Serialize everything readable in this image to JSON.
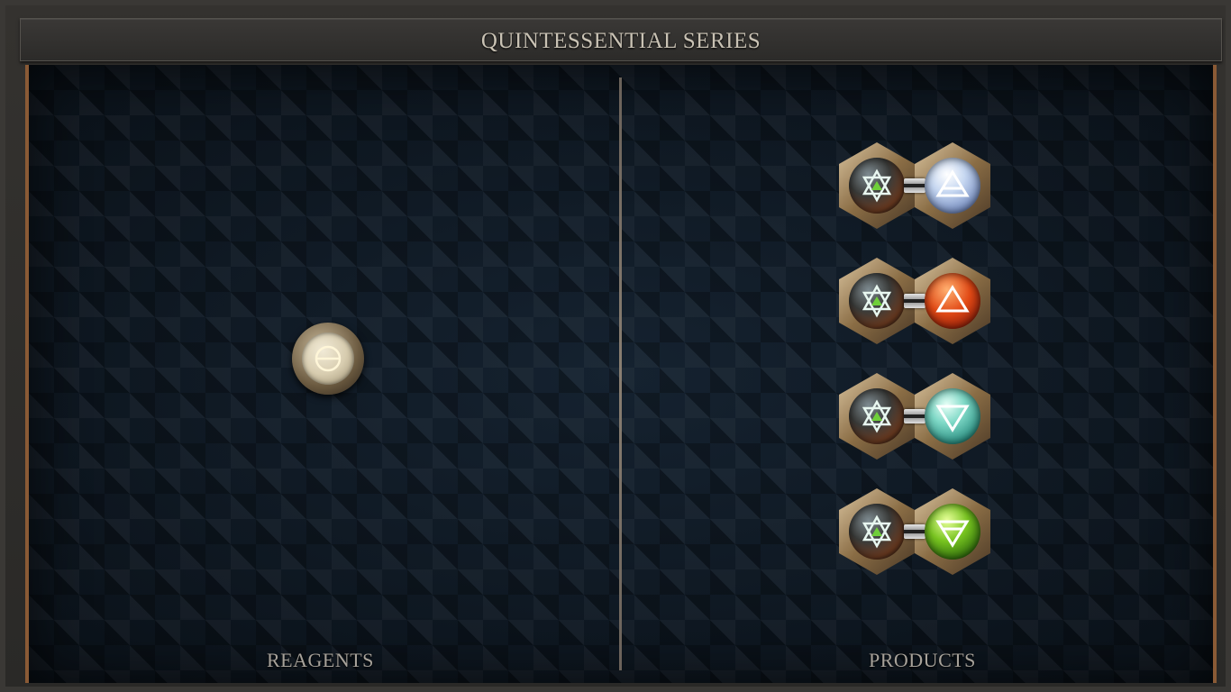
{
  "title": "QUINTESSENTIAL SERIES",
  "reagents_label": "REAGENTS",
  "products_label": "PRODUCTS",
  "reagent": {
    "element": "quintessence",
    "icon": "quintessence-symbol-icon",
    "color": "#e6dcc1"
  },
  "products": [
    {
      "left": "salt",
      "right": "air",
      "right_color": "#c6d7f1"
    },
    {
      "left": "salt",
      "right": "fire",
      "right_color": "#e24a16"
    },
    {
      "left": "salt",
      "right": "water",
      "right_color": "#248a7d"
    },
    {
      "left": "salt",
      "right": "earth",
      "right_color": "#78c420"
    }
  ]
}
